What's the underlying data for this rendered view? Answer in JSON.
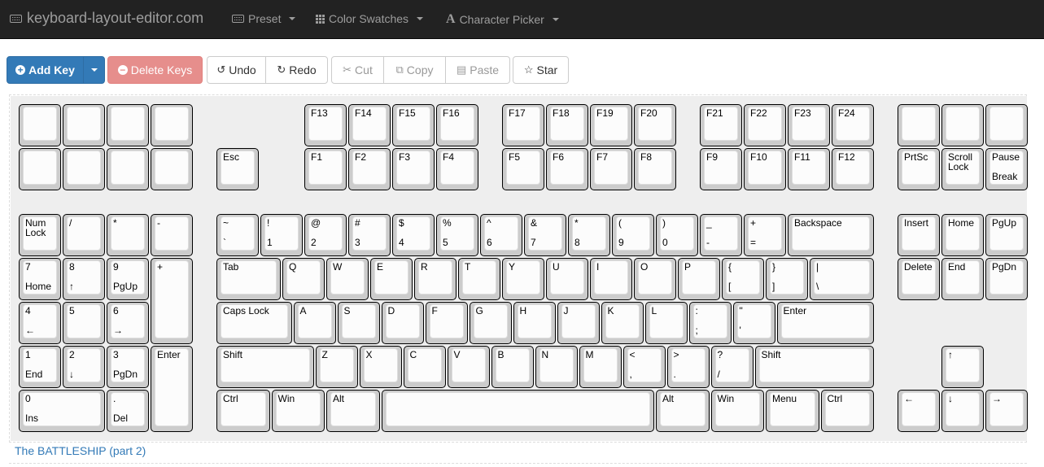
{
  "navbar": {
    "brand": "keyboard-layout-editor.com",
    "brand_icon": "keyboard-icon",
    "menus": [
      {
        "label": "Preset",
        "icon": "keyboard-icon"
      },
      {
        "label": "Color Swatches",
        "icon": "grid-icon"
      },
      {
        "label": "Character Picker",
        "icon": "font-icon"
      }
    ]
  },
  "toolbar": {
    "add_key": "Add Key",
    "delete_keys": "Delete Keys",
    "undo": "Undo",
    "redo": "Redo",
    "cut": "Cut",
    "copy": "Copy",
    "paste": "Paste",
    "star": "Star"
  },
  "layout_name": "The BATTLESHIP (part 2)",
  "colors": {
    "primary": "#337ab7",
    "danger": "#d9534f",
    "navbar": "#222222",
    "keyboard_bg": "#eeeeee",
    "key_color": "#cccccc"
  },
  "keys": {
    "r0": [
      {
        "t": "",
        "b": ""
      },
      {
        "t": "",
        "b": ""
      },
      {
        "t": "",
        "b": ""
      },
      {
        "t": "",
        "b": ""
      },
      {
        "t": "F13",
        "b": ""
      },
      {
        "t": "F14",
        "b": ""
      },
      {
        "t": "F15",
        "b": ""
      },
      {
        "t": "F16",
        "b": ""
      },
      {
        "t": "F17",
        "b": ""
      },
      {
        "t": "F18",
        "b": ""
      },
      {
        "t": "F19",
        "b": ""
      },
      {
        "t": "F20",
        "b": ""
      },
      {
        "t": "F21",
        "b": ""
      },
      {
        "t": "F22",
        "b": ""
      },
      {
        "t": "F23",
        "b": ""
      },
      {
        "t": "F24",
        "b": ""
      },
      {
        "t": "",
        "b": ""
      },
      {
        "t": "",
        "b": ""
      },
      {
        "t": "",
        "b": ""
      }
    ],
    "r1": [
      {
        "t": "",
        "b": ""
      },
      {
        "t": "",
        "b": ""
      },
      {
        "t": "",
        "b": ""
      },
      {
        "t": "",
        "b": ""
      },
      {
        "t": "Esc",
        "b": ""
      },
      {
        "t": "F1",
        "b": ""
      },
      {
        "t": "F2",
        "b": ""
      },
      {
        "t": "F3",
        "b": ""
      },
      {
        "t": "F4",
        "b": ""
      },
      {
        "t": "F5",
        "b": ""
      },
      {
        "t": "F6",
        "b": ""
      },
      {
        "t": "F7",
        "b": ""
      },
      {
        "t": "F8",
        "b": ""
      },
      {
        "t": "F9",
        "b": ""
      },
      {
        "t": "F10",
        "b": ""
      },
      {
        "t": "F11",
        "b": ""
      },
      {
        "t": "F12",
        "b": ""
      },
      {
        "t": "PrtSc",
        "b": ""
      },
      {
        "t": "Scroll\nLock",
        "b": ""
      },
      {
        "t": "Pause",
        "b": "Break"
      }
    ],
    "numpad": [
      {
        "t": "Num\nLock",
        "b": ""
      },
      {
        "t": "/",
        "b": ""
      },
      {
        "t": "*",
        "b": ""
      },
      {
        "t": "-",
        "b": ""
      },
      {
        "t": "7",
        "b": "Home"
      },
      {
        "t": "8",
        "b": "↑"
      },
      {
        "t": "9",
        "b": "PgUp"
      },
      {
        "t": "+",
        "b": ""
      },
      {
        "t": "4",
        "b": "←"
      },
      {
        "t": "5",
        "b": ""
      },
      {
        "t": "6",
        "b": "→"
      },
      {
        "t": "1",
        "b": "End"
      },
      {
        "t": "2",
        "b": "↓"
      },
      {
        "t": "3",
        "b": "PgDn"
      },
      {
        "t": "Enter",
        "b": ""
      },
      {
        "t": "0",
        "b": "Ins"
      },
      {
        "t": ".",
        "b": "Del"
      }
    ],
    "main_r1": [
      {
        "t": "~",
        "b": "`"
      },
      {
        "t": "!",
        "b": "1"
      },
      {
        "t": "@",
        "b": "2"
      },
      {
        "t": "#",
        "b": "3"
      },
      {
        "t": "$",
        "b": "4"
      },
      {
        "t": "%",
        "b": "5"
      },
      {
        "t": "^",
        "b": "6"
      },
      {
        "t": "&",
        "b": "7"
      },
      {
        "t": "*",
        "b": "8"
      },
      {
        "t": "(",
        "b": "9"
      },
      {
        "t": ")",
        "b": "0"
      },
      {
        "t": "_",
        "b": "-"
      },
      {
        "t": "+",
        "b": "="
      },
      {
        "t": "Backspace",
        "b": ""
      }
    ],
    "main_r2": [
      {
        "t": "Tab",
        "b": ""
      },
      {
        "t": "Q",
        "b": ""
      },
      {
        "t": "W",
        "b": ""
      },
      {
        "t": "E",
        "b": ""
      },
      {
        "t": "R",
        "b": ""
      },
      {
        "t": "T",
        "b": ""
      },
      {
        "t": "Y",
        "b": ""
      },
      {
        "t": "U",
        "b": ""
      },
      {
        "t": "I",
        "b": ""
      },
      {
        "t": "O",
        "b": ""
      },
      {
        "t": "P",
        "b": ""
      },
      {
        "t": "{",
        "b": "["
      },
      {
        "t": "}",
        "b": "]"
      },
      {
        "t": "|",
        "b": "\\"
      }
    ],
    "main_r3": [
      {
        "t": "Caps Lock",
        "b": ""
      },
      {
        "t": "A",
        "b": ""
      },
      {
        "t": "S",
        "b": ""
      },
      {
        "t": "D",
        "b": ""
      },
      {
        "t": "F",
        "b": ""
      },
      {
        "t": "G",
        "b": ""
      },
      {
        "t": "H",
        "b": ""
      },
      {
        "t": "J",
        "b": ""
      },
      {
        "t": "K",
        "b": ""
      },
      {
        "t": "L",
        "b": ""
      },
      {
        "t": ":",
        "b": ";"
      },
      {
        "t": "\"",
        "b": "'"
      },
      {
        "t": "Enter",
        "b": ""
      }
    ],
    "main_r4": [
      {
        "t": "Shift",
        "b": ""
      },
      {
        "t": "Z",
        "b": ""
      },
      {
        "t": "X",
        "b": ""
      },
      {
        "t": "C",
        "b": ""
      },
      {
        "t": "V",
        "b": ""
      },
      {
        "t": "B",
        "b": ""
      },
      {
        "t": "N",
        "b": ""
      },
      {
        "t": "M",
        "b": ""
      },
      {
        "t": "<",
        "b": ","
      },
      {
        "t": ">",
        "b": "."
      },
      {
        "t": "?",
        "b": "/"
      },
      {
        "t": "Shift",
        "b": ""
      }
    ],
    "main_r5": [
      {
        "t": "Ctrl",
        "b": ""
      },
      {
        "t": "Win",
        "b": ""
      },
      {
        "t": "Alt",
        "b": ""
      },
      {
        "t": "",
        "b": ""
      },
      {
        "t": "Alt",
        "b": ""
      },
      {
        "t": "Win",
        "b": ""
      },
      {
        "t": "Menu",
        "b": ""
      },
      {
        "t": "Ctrl",
        "b": ""
      }
    ],
    "nav": [
      {
        "t": "Insert",
        "b": ""
      },
      {
        "t": "Home",
        "b": ""
      },
      {
        "t": "PgUp",
        "b": ""
      },
      {
        "t": "Delete",
        "b": ""
      },
      {
        "t": "End",
        "b": ""
      },
      {
        "t": "PgDn",
        "b": ""
      },
      {
        "t": "↑",
        "b": ""
      },
      {
        "t": "←",
        "b": ""
      },
      {
        "t": "↓",
        "b": ""
      },
      {
        "t": "→",
        "b": ""
      }
    ]
  }
}
